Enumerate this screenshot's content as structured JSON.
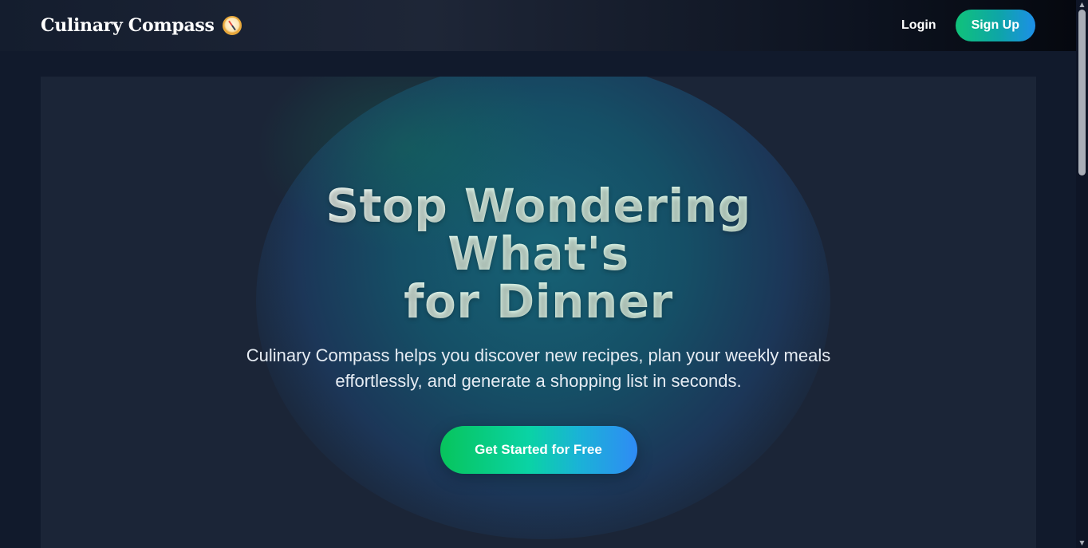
{
  "navbar": {
    "brand_name": "Culinary Compass",
    "brand_icon": "compass-icon",
    "login_label": "Login",
    "signup_label": "Sign Up"
  },
  "hero": {
    "title_line1": "Stop Wondering What's",
    "title_line2": "for Dinner",
    "subtitle": "Culinary Compass helps you discover new recipes, plan your weekly meals effortlessly, and generate a shopping list in seconds.",
    "cta_label": "Get Started for Free"
  },
  "colors": {
    "page_background": "#111a2c",
    "hero_background": "#1b2537",
    "accent_green": "#10c27a",
    "accent_blue": "#2f8bf5"
  }
}
